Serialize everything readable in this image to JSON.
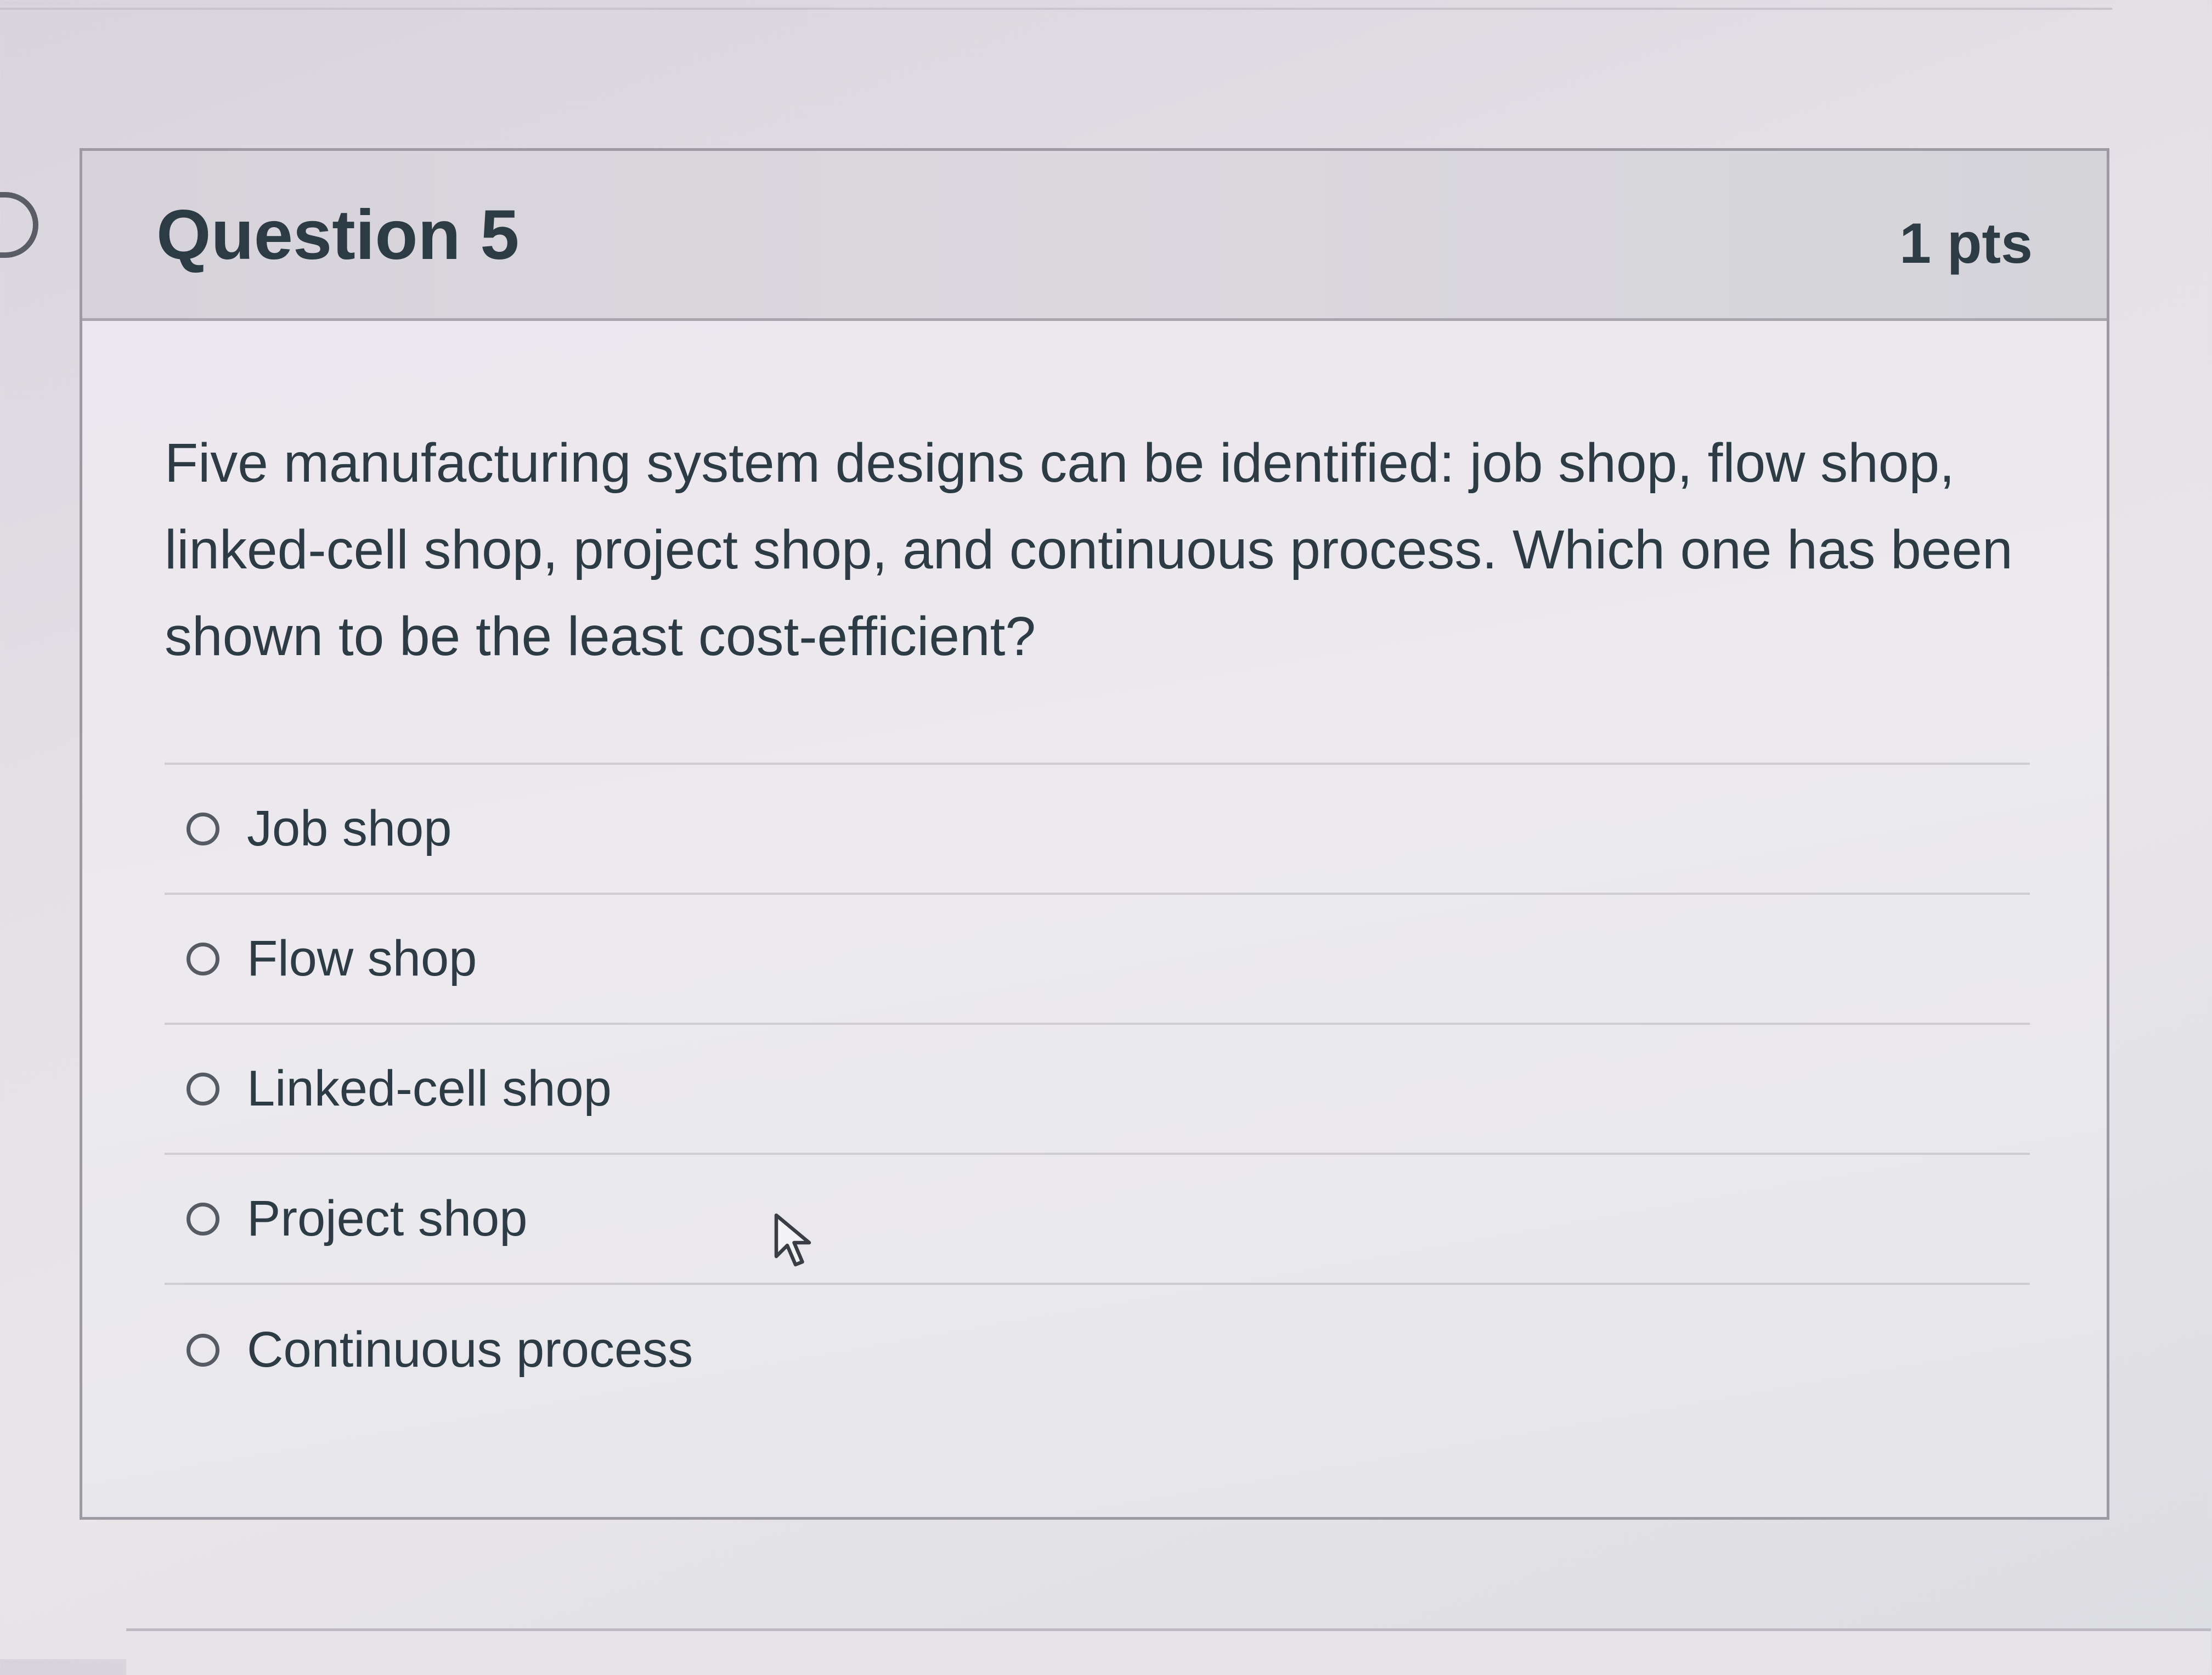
{
  "question": {
    "title": "Question 5",
    "points": "1 pts",
    "text": "Five manufacturing system designs can be identified: job shop, flow shop, linked-cell shop, project shop, and continuous process. Which one has been shown to be the least cost-efficient?"
  },
  "answers": [
    {
      "label": "Job shop"
    },
    {
      "label": "Flow shop"
    },
    {
      "label": "Linked-cell shop"
    },
    {
      "label": "Project shop"
    },
    {
      "label": "Continuous process"
    }
  ],
  "icons": {
    "cursor": "mouse-pointer-icon",
    "radio": "radio-unselected-icon"
  }
}
